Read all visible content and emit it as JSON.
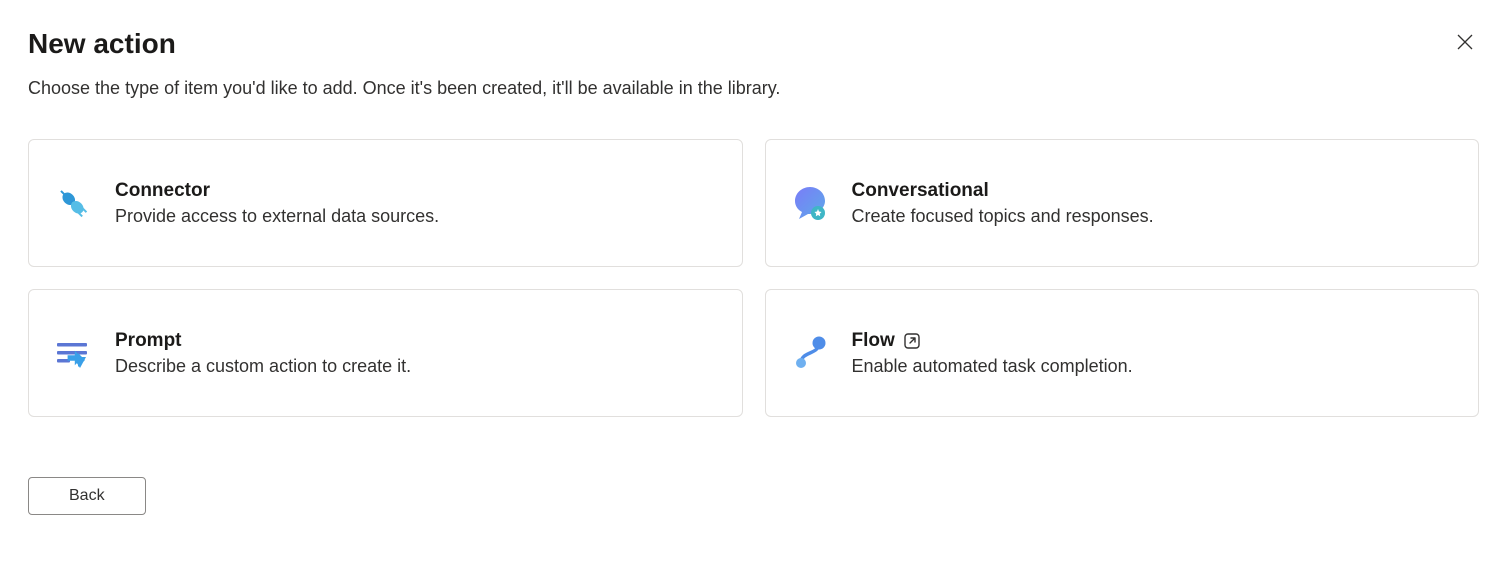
{
  "header": {
    "title": "New action"
  },
  "subtitle": "Choose the type of item you'd like to add. Once it's been created, it'll be available in the library.",
  "cards": {
    "connector": {
      "title": "Connector",
      "desc": "Provide access to external data sources."
    },
    "conversational": {
      "title": "Conversational",
      "desc": "Create focused topics and responses."
    },
    "prompt": {
      "title": "Prompt",
      "desc": "Describe a custom action to create it."
    },
    "flow": {
      "title": "Flow",
      "desc": "Enable automated task completion."
    }
  },
  "buttons": {
    "back": "Back"
  }
}
